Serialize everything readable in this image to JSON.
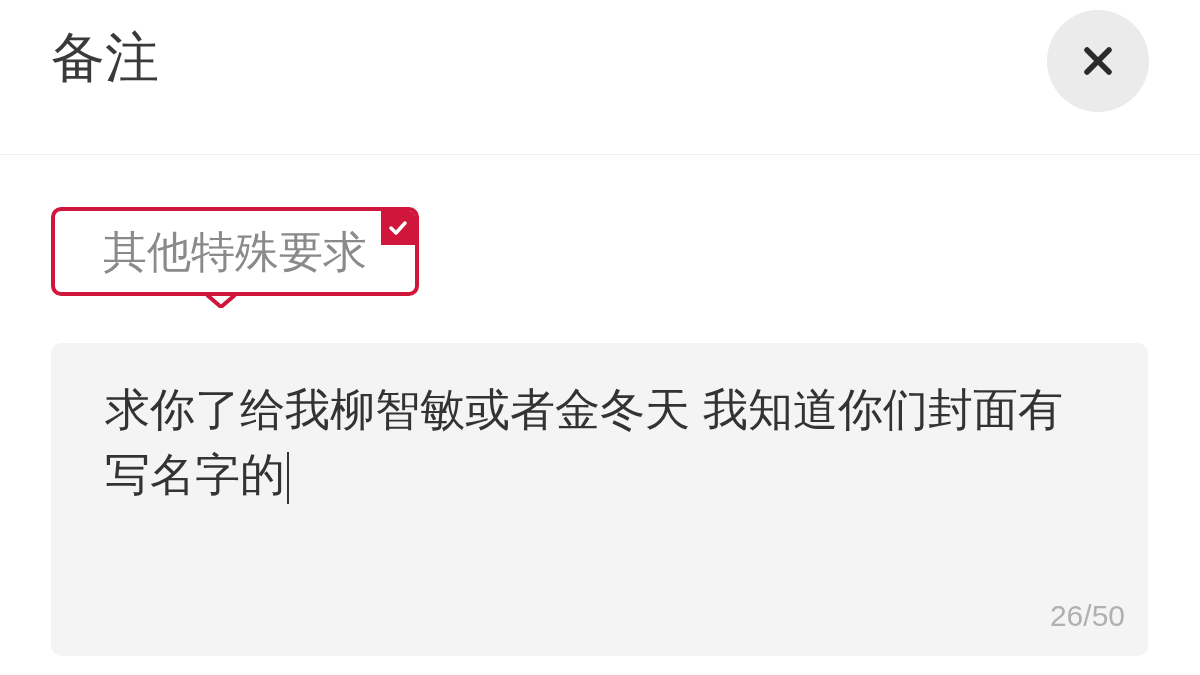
{
  "title": "备注",
  "tags": [
    {
      "label": "其他特殊要求",
      "selected": true
    }
  ],
  "remark": {
    "value": "求你了给我柳智敏或者金冬天 我知道你们封面有写名字的",
    "counter": "26/50"
  }
}
